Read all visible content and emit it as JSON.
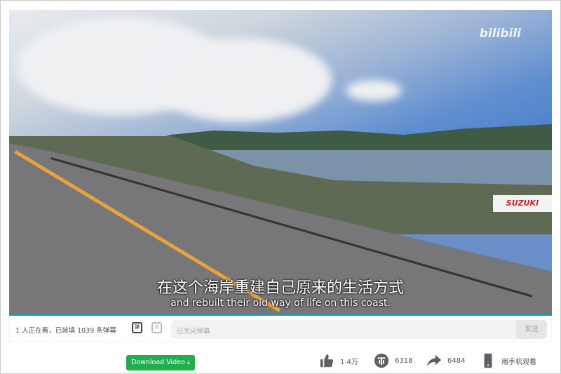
{
  "video": {
    "logo": "bilibili",
    "subtitle_zh": "在这个海岸重建自己原来的生活方式",
    "subtitle_en": "and rebuilt their old way of life on this coast.",
    "sign_text": "SUZUKI"
  },
  "danmaku": {
    "count_text": "1 人正在看，已装填 1039 条弹幕",
    "toggle_icon": "danmaku-on-icon",
    "settings_icon": "danmaku-settings-icon",
    "placeholder": "已关闭弹幕",
    "send_label": "发送"
  },
  "download": {
    "label": "Download Video"
  },
  "stats": {
    "likes": "1.4万",
    "coins": "6318",
    "shares": "6484",
    "mobile": "用手机观看"
  },
  "colors": {
    "progress": "#00a1d6",
    "download": "#1fae4c"
  }
}
